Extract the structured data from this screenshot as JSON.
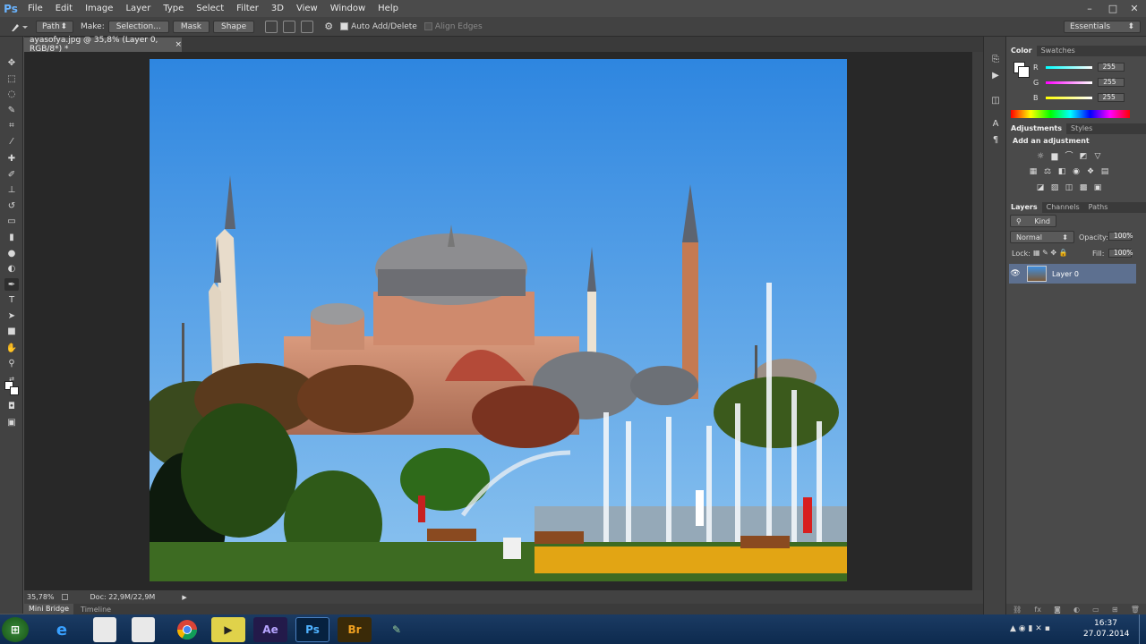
{
  "app": {
    "logo": "Ps",
    "menus": [
      "File",
      "Edit",
      "Image",
      "Layer",
      "Type",
      "Select",
      "Filter",
      "3D",
      "View",
      "Window",
      "Help"
    ],
    "window_controls": [
      "–",
      "□",
      "✕"
    ]
  },
  "options_bar": {
    "tool_mode": "Path",
    "make_label": "Make:",
    "selection_btn": "Selection...",
    "mask_btn": "Mask",
    "shape_btn": "Shape",
    "auto_add_delete": "Auto Add/Delete",
    "align_edges": "Align Edges",
    "workspace": "Essentials"
  },
  "document": {
    "tab_title": "ayasofya.jpg @ 35,8% (Layer 0, RGB/8*) *",
    "tab_close": "×"
  },
  "status_bar": {
    "zoom": "35,78%",
    "doc_size": "Doc: 22,9M/22,9M"
  },
  "bottom_tabs": [
    "Mini Bridge",
    "Timeline"
  ],
  "color_panel": {
    "tabs": [
      "Color",
      "Swatches"
    ],
    "channels": [
      {
        "label": "R",
        "value": "255"
      },
      {
        "label": "G",
        "value": "255"
      },
      {
        "label": "B",
        "value": "255"
      }
    ]
  },
  "adjustments_panel": {
    "tabs": [
      "Adjustments",
      "Styles"
    ],
    "title": "Add an adjustment"
  },
  "layers_panel": {
    "tabs": [
      "Layers",
      "Channels",
      "Paths"
    ],
    "kind_filter": "Kind",
    "blend_mode": "Normal",
    "opacity_label": "Opacity:",
    "opacity": "100%",
    "lock_label": "Lock:",
    "fill_label": "Fill:",
    "fill": "100%",
    "layers": [
      {
        "name": "Layer 0",
        "visible": true
      }
    ]
  },
  "taskbar": {
    "apps": [
      "Internet Explorer",
      "Calculator",
      "Calculator",
      "Google Chrome",
      "Video Editor",
      "After Effects",
      "Photoshop",
      "Bridge",
      "Editor"
    ],
    "app_glyphs": {
      "ae": "Ae",
      "ps": "Ps",
      "br": "Br"
    },
    "time": "16:37",
    "date": "27.07.2014"
  },
  "colors": {
    "accent": "#6ab4ff",
    "panel_bg": "#4a4a4a",
    "canvas_bg": "#282828",
    "sky": "#3f8fe0"
  }
}
